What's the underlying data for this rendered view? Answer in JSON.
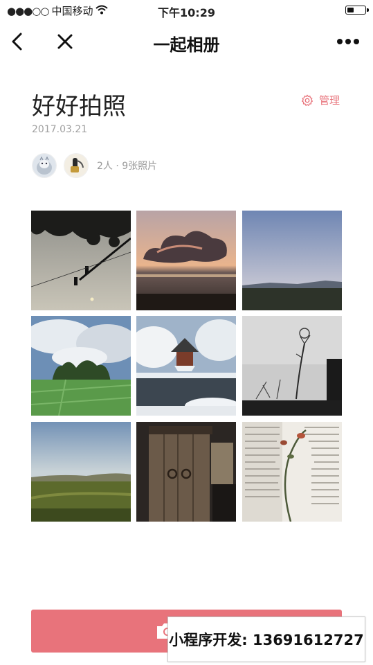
{
  "status_bar": {
    "carrier": "中国移动",
    "signal": "●●●○○",
    "time": "下午10:29"
  },
  "nav": {
    "title": "一起相册"
  },
  "album": {
    "title": "好好拍照",
    "date": "2017.03.21",
    "manage_label": "管理",
    "members_text": "2人 · 9张照片"
  },
  "watermark": {
    "text": "小程序开发: 13691612727"
  },
  "colors": {
    "accent": "#e8737b",
    "muted": "#a0a0a0"
  }
}
